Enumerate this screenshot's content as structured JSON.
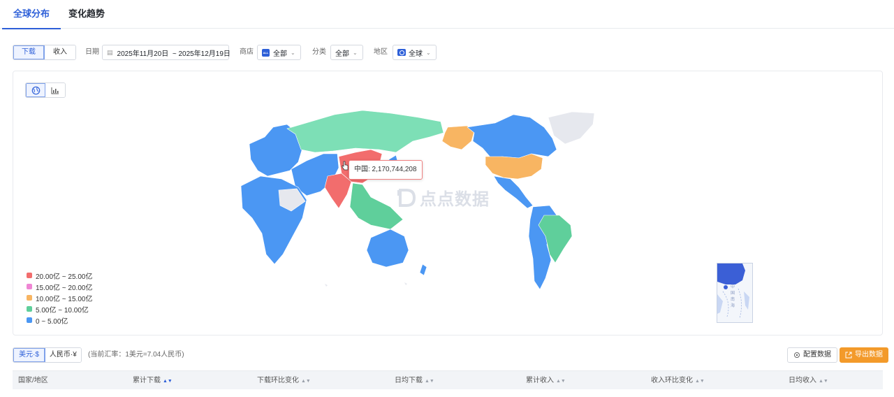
{
  "tabs": [
    {
      "label": "全球分布",
      "active": true
    },
    {
      "label": "变化趋势",
      "active": false
    }
  ],
  "filters": {
    "metric_toggle": [
      {
        "label": "下载",
        "active": true
      },
      {
        "label": "收入",
        "active": false
      }
    ],
    "date_label": "日期",
    "date_range": "2025年11月20日  ~ 2025年12月19日",
    "store_label": "商店",
    "store_value": "全部",
    "store_badge": "ALL",
    "category_label": "分类",
    "category_value": "全部",
    "region_label": "地区",
    "region_value": "全球"
  },
  "map": {
    "tooltip": "中国: 2,170,744,208",
    "watermark": "点点数据",
    "legend": [
      {
        "label": "20.00亿 ~ 25.00亿",
        "color": "#f26d6d"
      },
      {
        "label": "15.00亿 ~ 20.00亿",
        "color": "#ef86d4"
      },
      {
        "label": "10.00亿 ~ 15.00亿",
        "color": "#f8b562"
      },
      {
        "label": "5.00亿 ~ 10.00亿",
        "color": "#5fcf9b"
      },
      {
        "label": "0 ~ 5.00亿",
        "color": "#4b97f3"
      }
    ],
    "inset_label": "中国南海",
    "colors": {
      "none": "#e6e8ee",
      "russia": "#7ddfb6",
      "highlight": "#3b5fd6"
    }
  },
  "currency": {
    "options": [
      {
        "label": "美元·$",
        "active": true
      },
      {
        "label": "人民币·¥",
        "active": false
      }
    ],
    "note": "(当前汇率：1美元=7.04人民币)"
  },
  "actions": {
    "config": "配置数据",
    "export": "导出数据"
  },
  "table": {
    "columns": [
      {
        "label": "国家/地区",
        "sortable": false
      },
      {
        "label": "累计下载",
        "sortable": true,
        "sorted": true
      },
      {
        "label": "下载环比变化",
        "sortable": true
      },
      {
        "label": "日均下载",
        "sortable": true
      },
      {
        "label": "累计收入",
        "sortable": true
      },
      {
        "label": "收入环比变化",
        "sortable": true
      },
      {
        "label": "日均收入",
        "sortable": true
      }
    ]
  }
}
